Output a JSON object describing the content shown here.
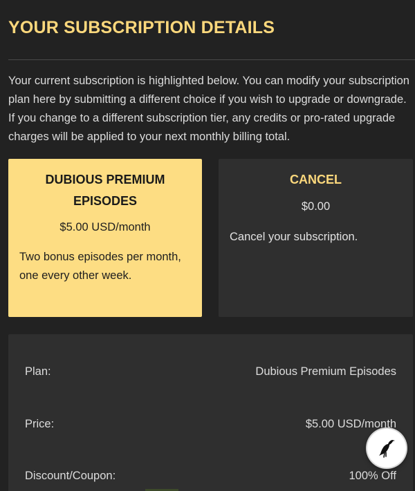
{
  "page": {
    "title": "YOUR SUBSCRIPTION DETAILS",
    "intro": "Your current subscription is highlighted below. You can modify your subscription plan here by submitting a different choice if you wish to upgrade or downgrade. If you change to a different subscription tier, any credits or pro-rated upgrade charges will be applied to your next monthly billing total."
  },
  "plans": [
    {
      "name": "DUBIOUS PREMIUM EPISODES",
      "price": "$5.00 USD/month",
      "description": "Two bonus episodes per month, one every other week.",
      "selected": true
    },
    {
      "name": "CANCEL",
      "price": "$0.00",
      "description": "Cancel your subscription.",
      "selected": false
    }
  ],
  "details": {
    "plan": {
      "label": "Plan:",
      "value": "Dubious Premium Episodes"
    },
    "price": {
      "label": "Price:",
      "value": "$5.00 USD/month"
    },
    "discount": {
      "label": "Discount/Coupon:",
      "value": "100% Off"
    }
  },
  "widget": {
    "icon": "bird-icon"
  },
  "colors": {
    "background": "#222222",
    "accent": "#fcd87c",
    "selected_card": "#fddd83",
    "card": "#2f2f2f"
  }
}
